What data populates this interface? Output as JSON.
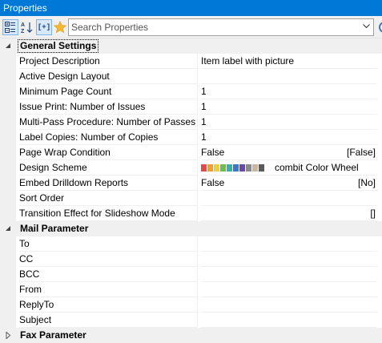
{
  "window": {
    "title": "Properties"
  },
  "toolbar": {
    "categorized_icon": "categorized-view-icon",
    "alphabetical_icon": "sort-alphabetical-icon",
    "expression_icon": "expression-mode-icon",
    "expression_label": "[+]",
    "favorites_icon": "star-icon",
    "search_placeholder": "Search Properties",
    "search_value": ""
  },
  "sections": [
    {
      "label": "General Settings",
      "expanded": true,
      "properties": [
        {
          "name": "Project Description",
          "value": "Item label with picture",
          "badge": ""
        },
        {
          "name": "Active Design Layout",
          "value": "",
          "badge": ""
        },
        {
          "name": "Minimum Page Count",
          "value": "1",
          "badge": ""
        },
        {
          "name": "Issue Print: Number of Issues",
          "value": "1",
          "badge": ""
        },
        {
          "name": "Multi-Pass Procedure: Number of Passes",
          "value": "1",
          "badge": ""
        },
        {
          "name": "Label Copies: Number of Copies",
          "value": "1",
          "badge": ""
        },
        {
          "name": "Page Wrap Condition",
          "value": "False",
          "badge": "[False]"
        },
        {
          "name": "Design Scheme",
          "value": "combit Color Wheel",
          "badge": ""
        },
        {
          "name": "Embed Drilldown Reports",
          "value": "False",
          "badge": "[No]"
        },
        {
          "name": "Sort Order",
          "value": "",
          "badge": ""
        },
        {
          "name": "Transition Effect for Slideshow Mode",
          "value": "",
          "badge": "[]"
        }
      ]
    },
    {
      "label": "Mail Parameter",
      "expanded": true,
      "properties": [
        {
          "name": "To",
          "value": "",
          "badge": ""
        },
        {
          "name": "CC",
          "value": "",
          "badge": ""
        },
        {
          "name": "BCC",
          "value": "",
          "badge": ""
        },
        {
          "name": "From",
          "value": "",
          "badge": ""
        },
        {
          "name": "ReplyTo",
          "value": "",
          "badge": ""
        },
        {
          "name": "Subject",
          "value": "",
          "badge": ""
        }
      ]
    },
    {
      "label": "Fax Parameter",
      "expanded": false,
      "properties": []
    }
  ],
  "design_scheme_colors": [
    "#e24a4a",
    "#f0a030",
    "#e8d040",
    "#6cc04a",
    "#38b2a8",
    "#3a78c8",
    "#6a4aa8",
    "#8a8a8a",
    "#c8b8a0",
    "#5a5a5a"
  ],
  "colors": {
    "titlebar": "#0078d7",
    "category_bg": "#f0f0f0",
    "grid_line": "#f0f0f0"
  }
}
